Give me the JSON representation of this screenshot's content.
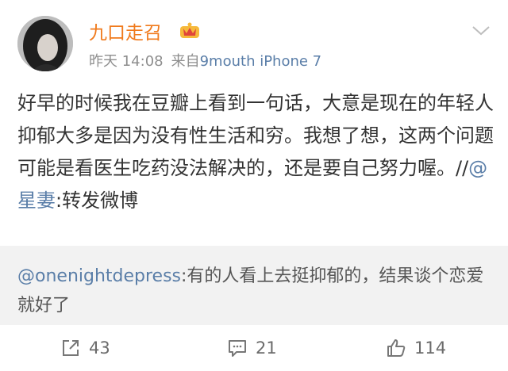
{
  "post": {
    "username": "九口走召",
    "time": "昨天 14:08",
    "source_prefix": "来自",
    "device": "9mouth iPhone 7",
    "text": "好早的时候我在豆瓣上看到一句话，大意是现在的年轻人抑郁大多是因为没有性生活和穷。我想了想，这两个问题可能是看医生吃药没法解决的，还是要自己努力喔。//",
    "mention": "@星妻",
    "text_tail": ":转发微博"
  },
  "repost": {
    "mention": "@onenightdepress",
    "text": ":有的人看上去挺抑郁的，结果谈个恋爱就好了"
  },
  "actions": {
    "reposts": "43",
    "comments": "21",
    "likes": "114"
  },
  "colors": {
    "username": "#f07a1c",
    "link": "#5a7ea8",
    "repost_bg": "#f2f2f2"
  },
  "icons": [
    "avatar",
    "vip-crown-icon",
    "chevron-down-icon",
    "repost-icon",
    "comment-icon",
    "like-icon"
  ]
}
